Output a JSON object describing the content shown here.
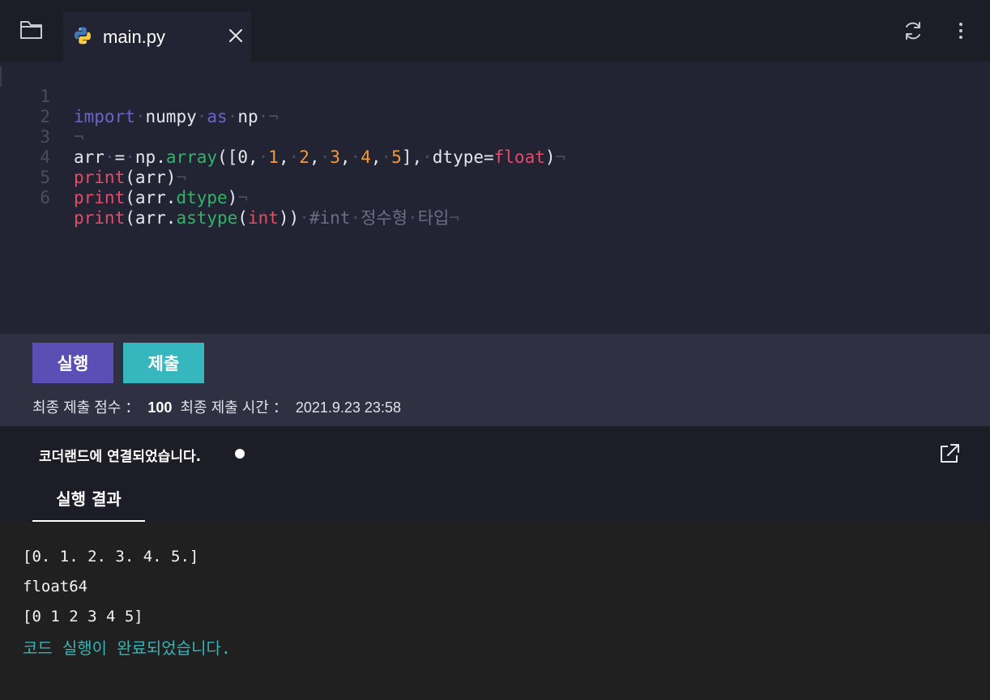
{
  "tabs": {
    "file_name": "main.py"
  },
  "editor": {
    "line_numbers": [
      "1",
      "2",
      "3",
      "4",
      "5",
      "6"
    ],
    "lines": [
      {
        "segments": [
          [
            "kw",
            "import"
          ],
          [
            "ws",
            "·"
          ],
          [
            "tx",
            "numpy"
          ],
          [
            "ws",
            "·"
          ],
          [
            "kw",
            "as"
          ],
          [
            "ws",
            "·"
          ],
          [
            "tx",
            "np"
          ],
          [
            "ws",
            "·¬"
          ]
        ]
      },
      {
        "segments": [
          [
            "ws",
            "¬"
          ]
        ]
      },
      {
        "segments": [
          [
            "tx",
            "arr"
          ],
          [
            "ws",
            "·"
          ],
          [
            "tx",
            "="
          ],
          [
            "ws",
            "·"
          ],
          [
            "tx",
            "np."
          ],
          [
            "mt",
            "array"
          ],
          [
            "tx",
            "([0,"
          ],
          [
            "ws",
            "·"
          ],
          [
            "num",
            "1"
          ],
          [
            "tx",
            ","
          ],
          [
            "ws",
            "·"
          ],
          [
            "num",
            "2"
          ],
          [
            "tx",
            ","
          ],
          [
            "ws",
            "·"
          ],
          [
            "num",
            "3"
          ],
          [
            "tx",
            ","
          ],
          [
            "ws",
            "·"
          ],
          [
            "num",
            "4"
          ],
          [
            "tx",
            ","
          ],
          [
            "ws",
            "·"
          ],
          [
            "num",
            "5"
          ],
          [
            "tx",
            "],"
          ],
          [
            "ws",
            "·"
          ],
          [
            "tx",
            "dtype="
          ],
          [
            "fn",
            "float"
          ],
          [
            "tx",
            ")"
          ],
          [
            "ws",
            "¬"
          ]
        ]
      },
      {
        "segments": [
          [
            "fn",
            "print"
          ],
          [
            "tx",
            "(arr)"
          ],
          [
            "ws",
            "¬"
          ]
        ]
      },
      {
        "segments": [
          [
            "fn",
            "print"
          ],
          [
            "tx",
            "(arr."
          ],
          [
            "mt",
            "dtype"
          ],
          [
            "tx",
            ")"
          ],
          [
            "ws",
            "¬"
          ]
        ]
      },
      {
        "segments": [
          [
            "fn",
            "print"
          ],
          [
            "tx",
            "(arr."
          ],
          [
            "mt",
            "astype"
          ],
          [
            "tx",
            "("
          ],
          [
            "fn",
            "int"
          ],
          [
            "tx",
            "))"
          ],
          [
            "ws",
            "·"
          ],
          [
            "cm",
            "#int"
          ],
          [
            "ws",
            "·"
          ],
          [
            "cm",
            "정수형"
          ],
          [
            "ws",
            "·"
          ],
          [
            "cm",
            "타입"
          ],
          [
            "ws",
            "¬"
          ]
        ]
      }
    ]
  },
  "actions": {
    "run_label": "실행",
    "submit_label": "제출",
    "score_label": "최종 제출 점수 ：",
    "score_value": "100",
    "time_label": "최종 제출 시간 ：",
    "time_value": "2021.9.23 23:58"
  },
  "status": {
    "connection_text": "코더랜드에 연결되었습니다."
  },
  "result": {
    "tab_label": "실행 결과",
    "output_lines": [
      "[0. 1. 2. 3. 4. 5.]",
      "float64",
      "[0 1 2 3 4 5]"
    ],
    "done_message": "코드 실행이 완료되었습니다."
  },
  "colors": {
    "run_button": "#5b4fb6",
    "submit_button": "#36b7bd",
    "done_message": "#35b3b6"
  },
  "icons": [
    "folder-icon",
    "python-icon",
    "close-icon",
    "refresh-icon",
    "more-vertical-icon",
    "external-link-icon"
  ]
}
